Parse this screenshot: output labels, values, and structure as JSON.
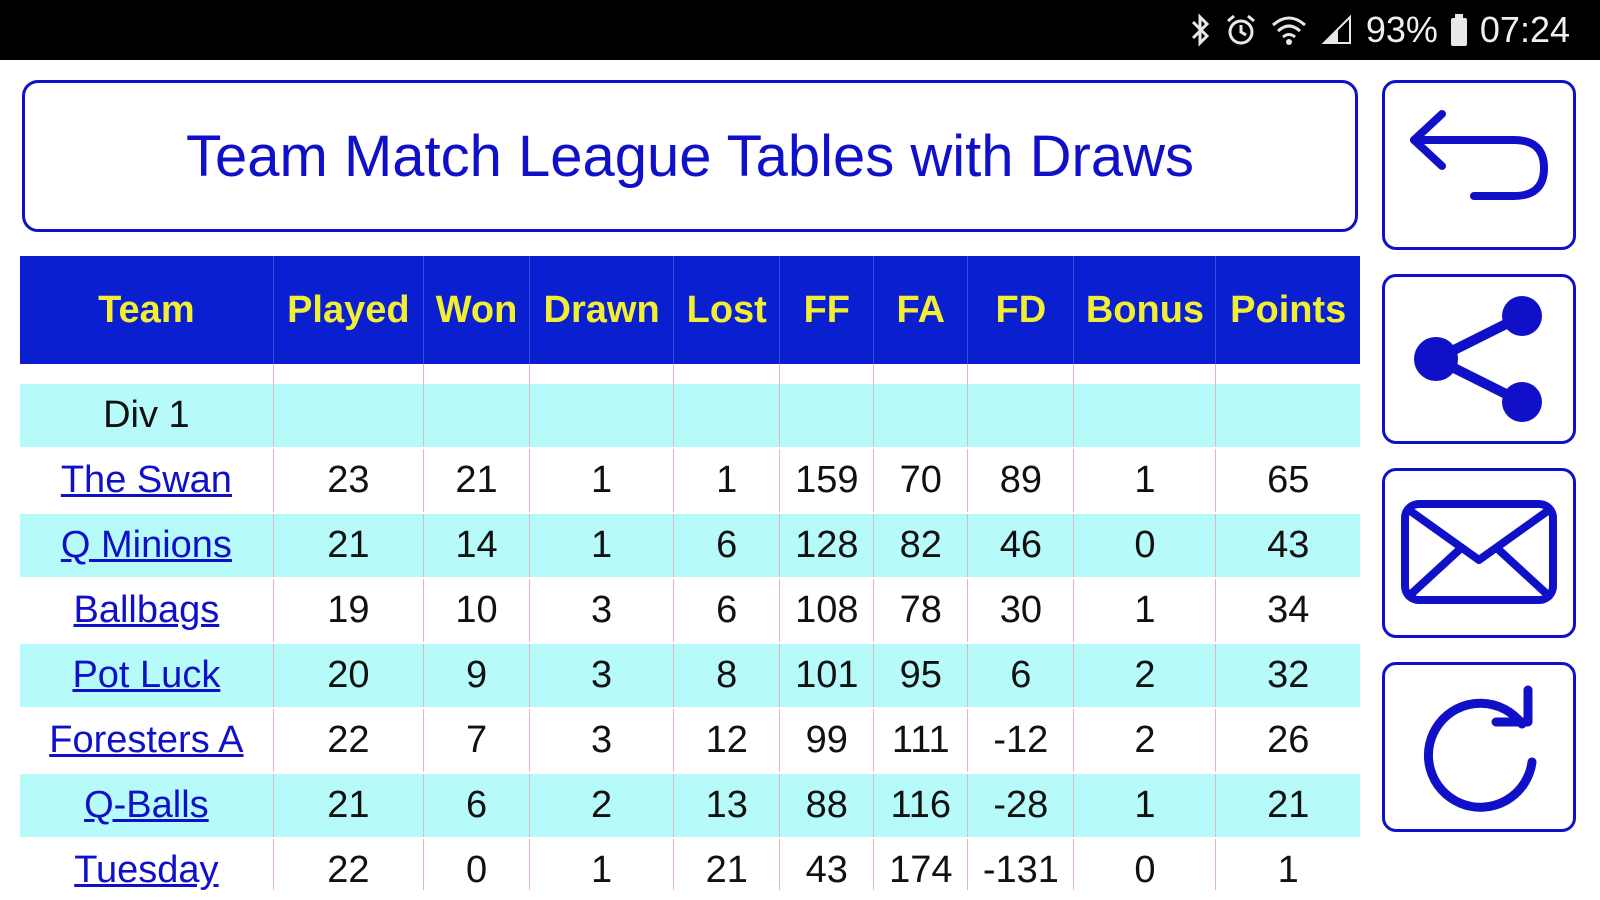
{
  "status_bar": {
    "battery": "93%",
    "time": "07:24",
    "icons": [
      "bluetooth-icon",
      "alarm-icon",
      "wifi-icon",
      "signal-icon",
      "battery-icon"
    ]
  },
  "header": {
    "title": "Team Match League Tables with Draws"
  },
  "side_buttons": [
    "back-arrow-icon",
    "share-icon",
    "email-icon",
    "refresh-icon"
  ],
  "table": {
    "columns": [
      "Team",
      "Played",
      "Won",
      "Drawn",
      "Lost",
      "FF",
      "FA",
      "FD",
      "Bonus",
      "Points"
    ],
    "division": "Div 1",
    "rows": [
      {
        "team": "The Swan",
        "played": "23",
        "won": "21",
        "drawn": "1",
        "lost": "1",
        "ff": "159",
        "fa": "70",
        "fd": "89",
        "bonus": "1",
        "points": "65"
      },
      {
        "team": "Q Minions",
        "played": "21",
        "won": "14",
        "drawn": "1",
        "lost": "6",
        "ff": "128",
        "fa": "82",
        "fd": "46",
        "bonus": "0",
        "points": "43"
      },
      {
        "team": "Ballbags",
        "played": "19",
        "won": "10",
        "drawn": "3",
        "lost": "6",
        "ff": "108",
        "fa": "78",
        "fd": "30",
        "bonus": "1",
        "points": "34"
      },
      {
        "team": "Pot Luck",
        "played": "20",
        "won": "9",
        "drawn": "3",
        "lost": "8",
        "ff": "101",
        "fa": "95",
        "fd": "6",
        "bonus": "2",
        "points": "32"
      },
      {
        "team": "Foresters A",
        "played": "22",
        "won": "7",
        "drawn": "3",
        "lost": "12",
        "ff": "99",
        "fa": "111",
        "fd": "-12",
        "bonus": "2",
        "points": "26"
      },
      {
        "team": "Q-Balls",
        "played": "21",
        "won": "6",
        "drawn": "2",
        "lost": "13",
        "ff": "88",
        "fa": "116",
        "fd": "-28",
        "bonus": "1",
        "points": "21"
      },
      {
        "team": "Tuesday",
        "played": "22",
        "won": "0",
        "drawn": "1",
        "lost": "21",
        "ff": "43",
        "fa": "174",
        "fd": "-131",
        "bonus": "0",
        "points": "1"
      }
    ]
  },
  "colors": {
    "accent": "#1010c8",
    "header_bg": "#0a1fd0",
    "header_text": "#f2ee34",
    "row_cyan": "#b6fafa"
  }
}
